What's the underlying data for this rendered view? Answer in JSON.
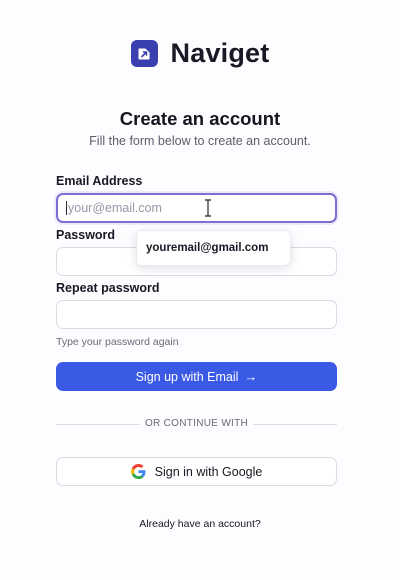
{
  "brand": {
    "name": "Naviget",
    "logo_icon": "naviget-logo-icon",
    "logo_color": "#3a3fb0"
  },
  "form": {
    "title": "Create an account",
    "subtitle": "Fill the form below to create an account.",
    "email": {
      "label": "Email Address",
      "placeholder": "your@email.com",
      "value": ""
    },
    "autocomplete_suggestion": "youremail@gmail.com",
    "password": {
      "label": "Password",
      "placeholder": "",
      "value": ""
    },
    "repeat_password": {
      "label": "Repeat password",
      "placeholder": "",
      "value": "",
      "hint": "Type your password again"
    },
    "submit_label": "Sign up with Email",
    "divider_text": "OR CONTINUE WITH",
    "google_label": "Sign in with Google",
    "login_prompt": "Already have an account?"
  },
  "colors": {
    "accent": "#3a5ae6",
    "focus_border": "#7b6fd6",
    "background": "#fdfcff"
  }
}
